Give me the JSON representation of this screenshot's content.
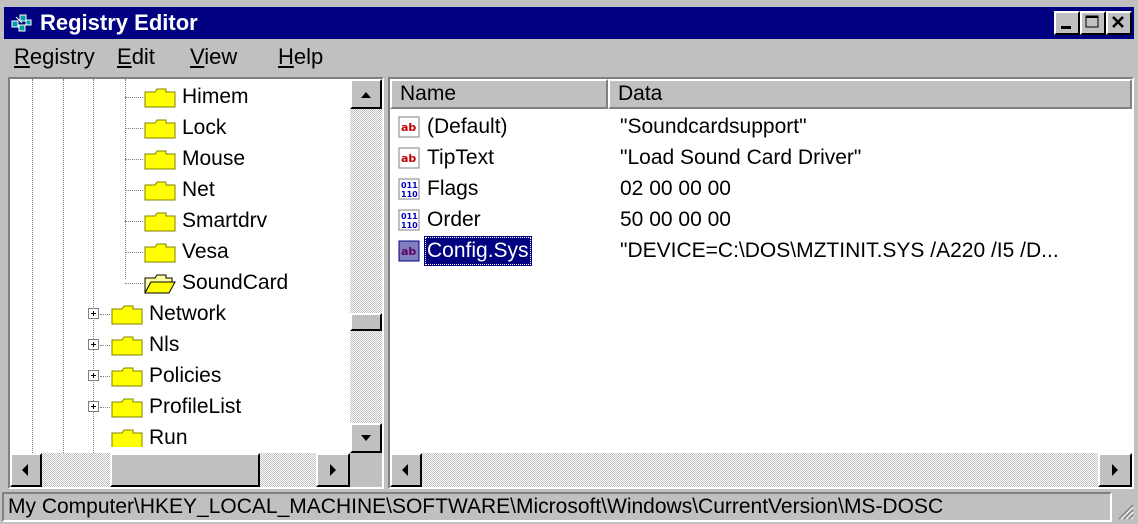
{
  "window": {
    "title": "Registry Editor",
    "title_icon": "registry-editor-icon",
    "controls": [
      "minimize",
      "maximize",
      "close"
    ]
  },
  "menu": {
    "items": [
      {
        "label": "Registry",
        "mnemonic": "R"
      },
      {
        "label": "Edit",
        "mnemonic": "E"
      },
      {
        "label": "View",
        "mnemonic": "V"
      },
      {
        "label": "Help",
        "mnemonic": "H"
      }
    ]
  },
  "tree": {
    "items": [
      {
        "label": "Himem",
        "expander": false
      },
      {
        "label": "Lock",
        "expander": false
      },
      {
        "label": "Mouse",
        "expander": false
      },
      {
        "label": "Net",
        "expander": false
      },
      {
        "label": "Smartdrv",
        "expander": false
      },
      {
        "label": "Vesa",
        "expander": false
      },
      {
        "label": "SoundCard",
        "expander": false,
        "open": true
      },
      {
        "label": "Network",
        "expander": true
      },
      {
        "label": "Nls",
        "expander": true
      },
      {
        "label": "Policies",
        "expander": true
      },
      {
        "label": "ProfileList",
        "expander": true
      },
      {
        "label": "Run",
        "expander": false
      }
    ]
  },
  "list": {
    "columns": {
      "name": "Name",
      "data": "Data"
    },
    "rows": [
      {
        "name": "(Default)",
        "data": "\"Soundcardsupport\"",
        "type": "string"
      },
      {
        "name": "TipText",
        "data": "\"Load Sound Card Driver\"",
        "type": "string"
      },
      {
        "name": "Flags",
        "data": "02 00 00 00",
        "type": "binary"
      },
      {
        "name": "Order",
        "data": "50 00 00 00",
        "type": "binary"
      },
      {
        "name": "Config.Sys",
        "data": "\"DEVICE=C:\\DOS\\MZTINIT.SYS /A220 /I5 /D...",
        "type": "string",
        "selected": true
      }
    ]
  },
  "statusbar": {
    "path": "My Computer\\HKEY_LOCAL_MACHINE\\SOFTWARE\\Microsoft\\Windows\\CurrentVersion\\MS-DOSC"
  },
  "colors": {
    "titlebar": "#000080",
    "face": "#c0c0c0",
    "selection": "#000080",
    "folder": "#ffff00"
  }
}
